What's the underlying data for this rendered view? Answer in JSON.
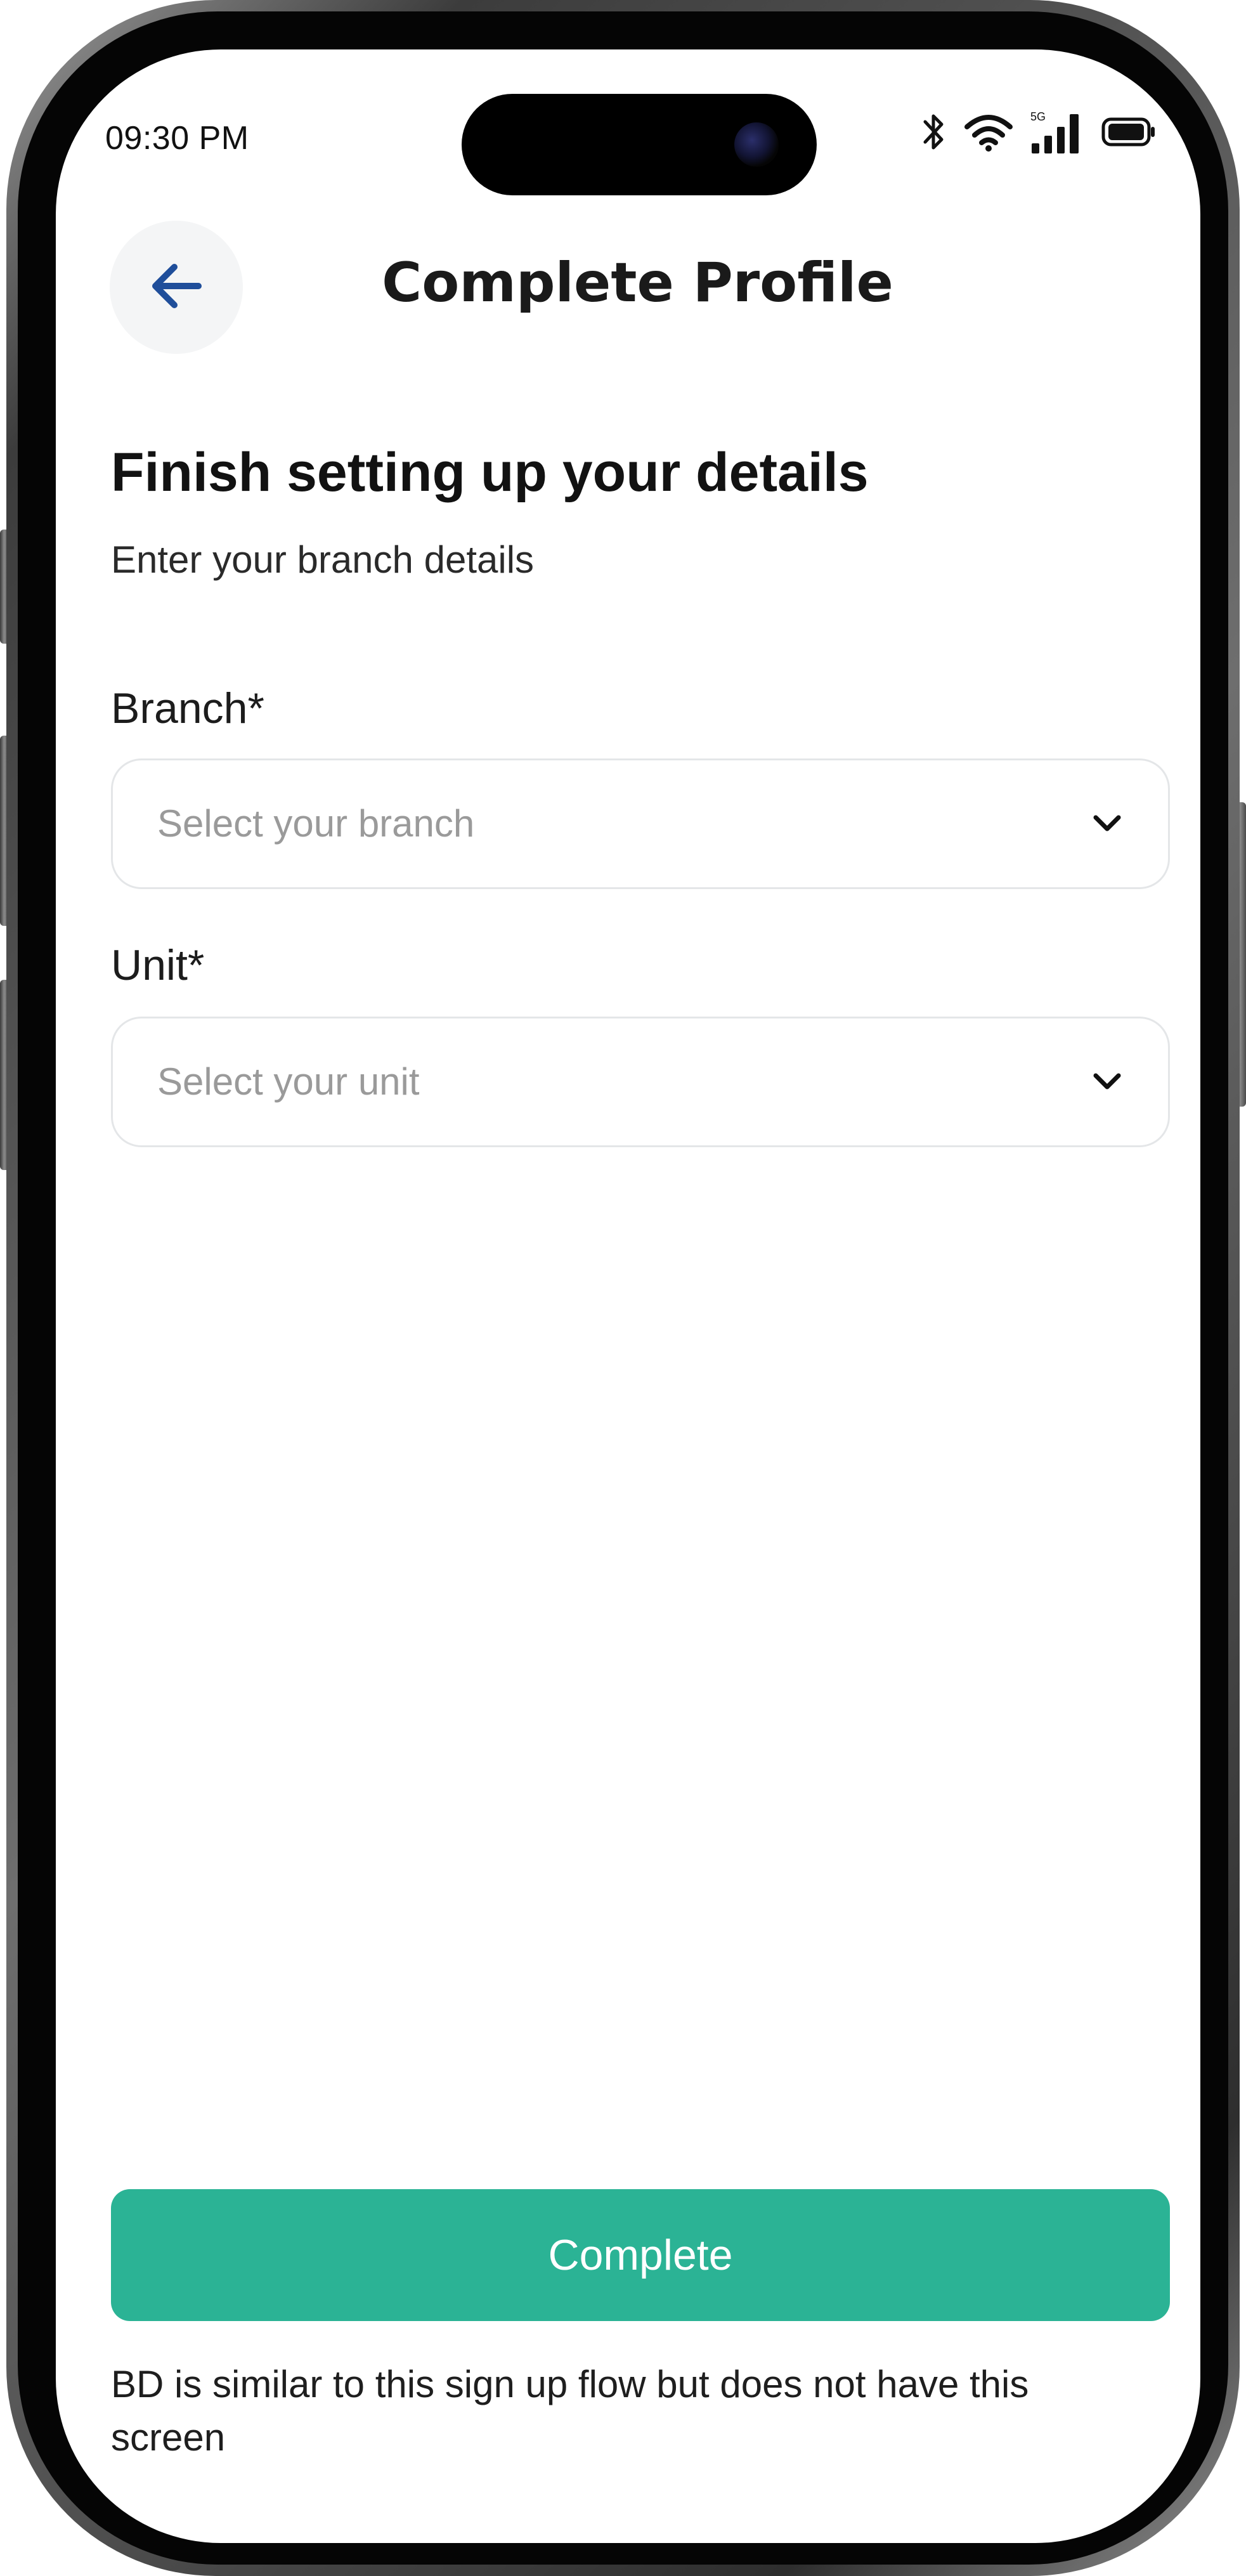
{
  "status_bar": {
    "time": "09:30 PM",
    "network_label": "5G",
    "icons": [
      "bluetooth-icon",
      "wifi-icon",
      "cellular-signal-icon",
      "battery-icon"
    ]
  },
  "header": {
    "back_icon": "arrow-left-icon",
    "title": "Complete Profile"
  },
  "content": {
    "heading": "Finish setting up your details",
    "subheading": "Enter your branch details",
    "fields": [
      {
        "label": "Branch*",
        "placeholder": "Select your branch",
        "icon": "chevron-down-icon"
      },
      {
        "label": "Unit*",
        "placeholder": "Select your unit",
        "icon": "chevron-down-icon"
      }
    ]
  },
  "footer": {
    "button_label": "Complete",
    "note": "BD is similar to this sign up flow but does not have this screen"
  },
  "colors": {
    "accent": "#2bb395",
    "back_arrow": "#1f4e9a",
    "back_button_bg": "#f4f5f6",
    "field_border": "#e4e6e8",
    "placeholder_text": "#9a9a9a"
  }
}
